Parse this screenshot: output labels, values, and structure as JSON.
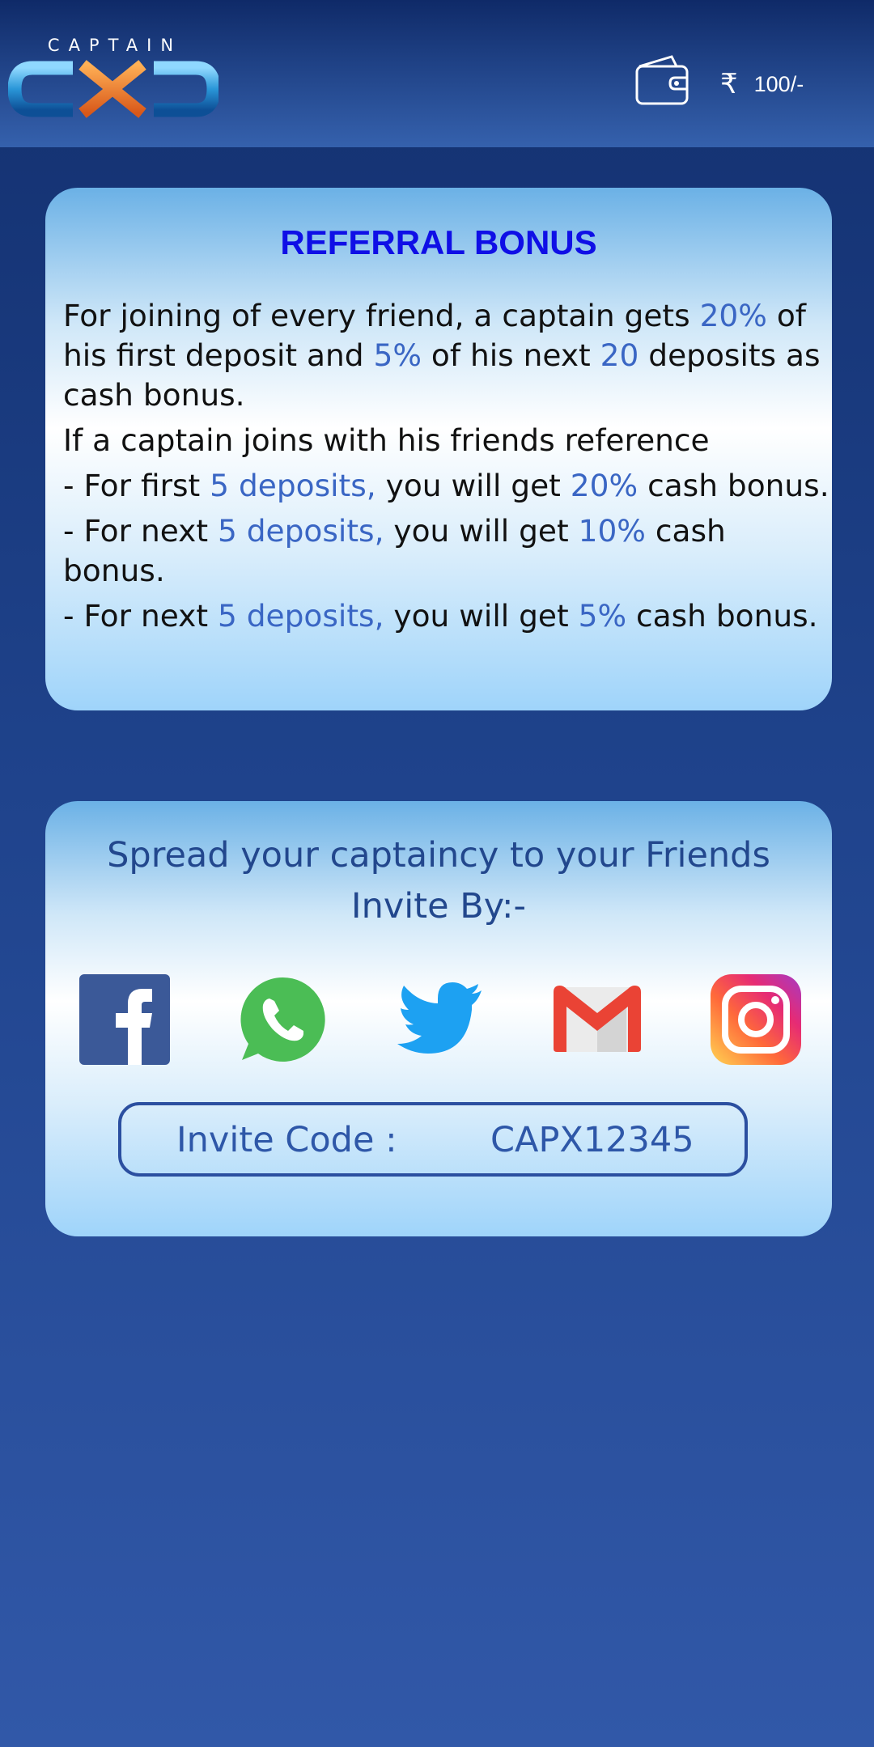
{
  "header": {
    "logo_text": "CAPTAIN",
    "logo_mark": "CXD",
    "currency_symbol": "₹",
    "balance": "100/-"
  },
  "referral": {
    "title": "REFERRAL BONUS",
    "p1": [
      "For joining of every friend, a captain gets ",
      "20%",
      " of his first deposit and ",
      "5%",
      " of his next ",
      "20",
      " deposits as cash bonus."
    ],
    "p2": "If a captain joins with his friends reference",
    "tiers": [
      [
        "- For first ",
        "5 deposits,",
        " you will get ",
        "20%",
        " cash bonus."
      ],
      [
        "- For next ",
        "5 deposits,",
        " you will get ",
        "10%",
        " cash bonus."
      ],
      [
        "- For next ",
        "5 deposits,",
        " you will get ",
        "5%",
        " cash bonus."
      ]
    ]
  },
  "invite": {
    "heading": "Spread your captaincy to your Friends",
    "subheading": "Invite By:-",
    "share_icons": [
      "facebook-icon",
      "whatsapp-icon",
      "twitter-icon",
      "gmail-icon",
      "instagram-icon"
    ],
    "code_label": "Invite Code :",
    "code_value": "CAPX12345"
  },
  "colors": {
    "accent_text": "#3a66c4",
    "title_blue": "#0f0fe6",
    "header_bg": "#1f438c",
    "logo_orange": "#f08a24"
  }
}
